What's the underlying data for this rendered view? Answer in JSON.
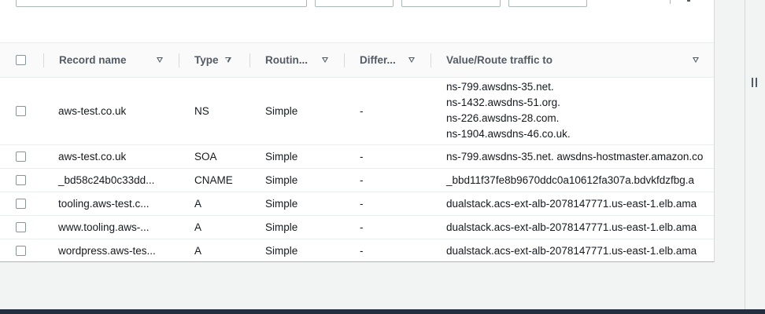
{
  "table": {
    "columns": [
      {
        "label": ""
      },
      {
        "label": "Record name"
      },
      {
        "label": "Type"
      },
      {
        "label": "Routin..."
      },
      {
        "label": "Differ..."
      },
      {
        "label": "Value/Route traffic to"
      }
    ],
    "rows": [
      {
        "record_name": "aws-test.co.uk",
        "type": "NS",
        "routing": "Simple",
        "differ": "-",
        "values": [
          "ns-799.awsdns-35.net.",
          "ns-1432.awsdns-51.org.",
          "ns-226.awsdns-28.com.",
          "ns-1904.awsdns-46.co.uk."
        ]
      },
      {
        "record_name": "aws-test.co.uk",
        "type": "SOA",
        "routing": "Simple",
        "differ": "-",
        "values": [
          "ns-799.awsdns-35.net. awsdns-hostmaster.amazon.co"
        ]
      },
      {
        "record_name": "_bd58c24b0c33dd...",
        "type": "CNAME",
        "routing": "Simple",
        "differ": "-",
        "values": [
          "_bbd11f37fe8b9670ddc0a10612fa307a.bdvkfdzfbg.a"
        ]
      },
      {
        "record_name": "tooling.aws-test.c...",
        "type": "A",
        "routing": "Simple",
        "differ": "-",
        "values": [
          "dualstack.acs-ext-alb-2078147771.us-east-1.elb.ama"
        ]
      },
      {
        "record_name": "www.tooling.aws-...",
        "type": "A",
        "routing": "Simple",
        "differ": "-",
        "values": [
          "dualstack.acs-ext-alb-2078147771.us-east-1.elb.ama"
        ]
      },
      {
        "record_name": "wordpress.aws-tes...",
        "type": "A",
        "routing": "Simple",
        "differ": "-",
        "values": [
          "dualstack.acs-ext-alb-2078147771.us-east-1.elb.ama"
        ]
      }
    ]
  },
  "icons": {
    "sort": "sort-down-icon",
    "pause": "pause-icon",
    "checkbox": "checkbox"
  },
  "colors": {
    "page_bg": "#f2f3f3",
    "panel_bg": "#ffffff",
    "header_text": "#545b64",
    "text": "#16191f",
    "bottom_bar": "#232f3e"
  }
}
